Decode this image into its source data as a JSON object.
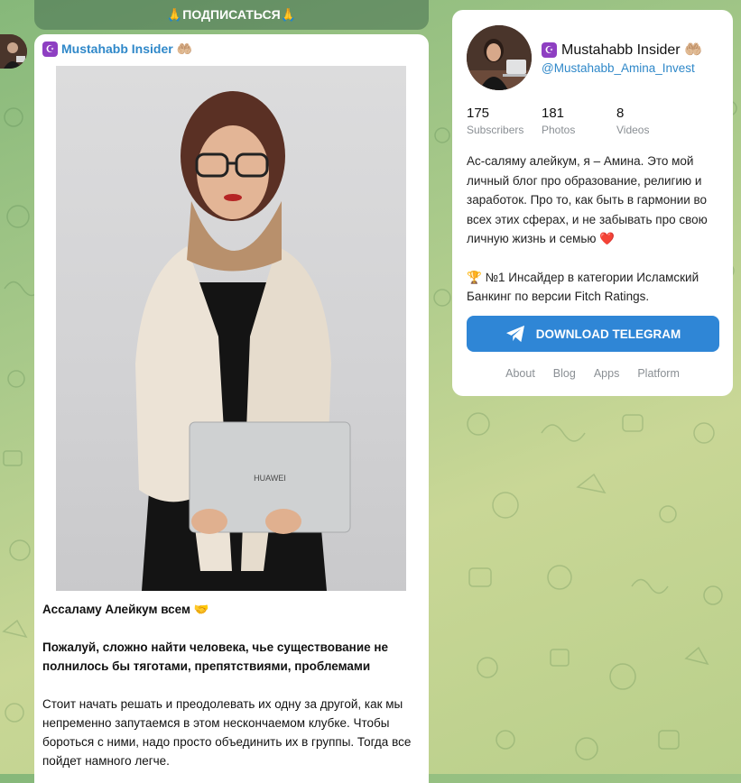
{
  "colors": {
    "accent": "#2f88c9",
    "button": "#2f86d6",
    "background_green": "#a8c98a"
  },
  "subscribe": {
    "label": "🙏ПОДПИСАТЬСЯ🙏"
  },
  "post": {
    "channel_name": "Mustahabb Insider 🤲🏼",
    "badge": "☪",
    "photo_laptop_brand": "HUAWEI",
    "greeting": "Ассаламу Алейкум всем 🤝",
    "paragraph_bold": "Пожалуй, сложно найти человека, чье существование не полнилось бы тяготами, препятствиями, проблемами",
    "paragraph": "Стоит начать решать и преодолевать их одну за другой, как мы непременно запутаемся в этом нескончаемом клубке. Чтобы бороться с ними, надо просто объединить их в группы. Тогда все пойдет намного легче."
  },
  "channel": {
    "name": "Mustahabb Insider 🤲🏼",
    "badge": "☪",
    "handle": "@Mustahabb_Amina_Invest",
    "stats": [
      {
        "value": "175",
        "label": "Subscribers"
      },
      {
        "value": "181",
        "label": "Photos"
      },
      {
        "value": "8",
        "label": "Videos"
      }
    ],
    "about_1": "Ас-саляму алейкум, я – Амина. Это мой личный блог про образование, религию и заработок. Про то, как быть в гармонии во всех этих сферах, и не забывать про свою личную жизнь и семью ❤️",
    "about_2": "🏆 №1 Инсайдер в категории Исламский Банкинг по версии Fitch Ratings.",
    "download_label": "DOWNLOAD TELEGRAM",
    "links": [
      "About",
      "Blog",
      "Apps",
      "Platform"
    ]
  }
}
